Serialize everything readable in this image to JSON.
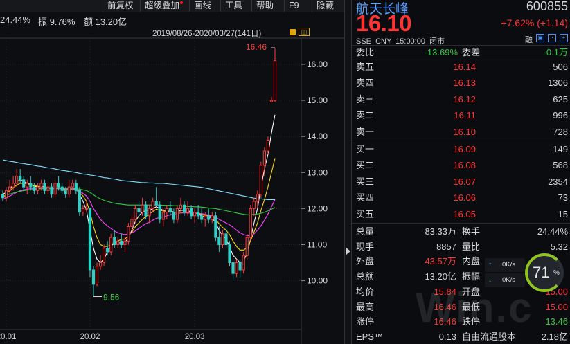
{
  "toolbar": {
    "items": [
      "前复权",
      "超级叠加",
      "画线",
      "工具",
      "帮助",
      "F9",
      "隐藏"
    ]
  },
  "stats": {
    "turnover": "24.44%",
    "amplitude": "振 9.76%",
    "amount": "额 13.20亿"
  },
  "range": "2019/08/26-2020/03/27(141日)",
  "chart_data": {
    "type": "candlestick",
    "title": "",
    "y_ticks": [
      10.0,
      11.0,
      12.0,
      13.0,
      14.0,
      15.0,
      16.0
    ],
    "y_tick_labels": [
      "10.00",
      "11.00",
      "12.00",
      "13.00",
      "14.00",
      "15.00",
      "16.00"
    ],
    "ylim": [
      9.35,
      16.85
    ],
    "x_tick_labels": [
      "20.01",
      "20.02",
      "20.03"
    ],
    "x_tick_index": [
      1,
      25,
      55
    ],
    "annotations": [
      {
        "label": "16.46",
        "index": 78,
        "value": 16.46
      },
      {
        "label": "9.56",
        "index": 26,
        "value": 9.56
      }
    ],
    "candles": [
      [
        12.4,
        12.5,
        12.2,
        12.3
      ],
      [
        12.3,
        12.6,
        12.2,
        12.5
      ],
      [
        12.5,
        12.8,
        12.4,
        12.6
      ],
      [
        12.6,
        12.9,
        12.5,
        12.7
      ],
      [
        12.7,
        13.1,
        12.6,
        12.9
      ],
      [
        12.9,
        13.1,
        12.7,
        12.8
      ],
      [
        12.8,
        12.9,
        12.5,
        12.6
      ],
      [
        12.6,
        12.8,
        12.4,
        12.7
      ],
      [
        12.7,
        12.9,
        12.5,
        12.6
      ],
      [
        12.6,
        12.7,
        12.4,
        12.5
      ],
      [
        12.5,
        12.7,
        12.4,
        12.6
      ],
      [
        12.6,
        12.8,
        12.5,
        12.7
      ],
      [
        12.7,
        12.8,
        12.4,
        12.5
      ],
      [
        12.5,
        12.7,
        12.4,
        12.6
      ],
      [
        12.6,
        12.7,
        12.3,
        12.4
      ],
      [
        12.4,
        12.8,
        12.3,
        12.7
      ],
      [
        12.7,
        12.9,
        12.5,
        12.6
      ],
      [
        12.6,
        12.7,
        12.4,
        12.5
      ],
      [
        12.5,
        12.6,
        12.3,
        12.4
      ],
      [
        12.4,
        12.8,
        12.3,
        12.6
      ],
      [
        12.6,
        12.8,
        12.5,
        12.7
      ],
      [
        12.7,
        12.8,
        12.4,
        12.5
      ],
      [
        12.5,
        12.6,
        11.8,
        11.9
      ],
      [
        11.9,
        12.1,
        11.8,
        12.0
      ],
      [
        12.0,
        12.2,
        11.9,
        12.0
      ],
      [
        12.0,
        12.0,
        10.1,
        10.3
      ],
      [
        10.3,
        10.4,
        9.56,
        9.9
      ],
      [
        9.9,
        10.5,
        9.85,
        10.4
      ],
      [
        10.4,
        10.7,
        10.3,
        10.5
      ],
      [
        10.5,
        11.0,
        10.4,
        10.9
      ],
      [
        10.9,
        11.1,
        10.7,
        10.8
      ],
      [
        10.8,
        11.3,
        10.7,
        11.2
      ],
      [
        11.2,
        11.4,
        10.9,
        11.0
      ],
      [
        11.0,
        11.2,
        10.9,
        11.1
      ],
      [
        11.1,
        11.3,
        10.9,
        11.0
      ],
      [
        11.0,
        11.2,
        10.8,
        11.1
      ],
      [
        11.1,
        11.6,
        11.0,
        11.5
      ],
      [
        11.5,
        11.8,
        11.4,
        11.7
      ],
      [
        11.7,
        12.1,
        11.6,
        12.0
      ],
      [
        12.0,
        12.2,
        11.8,
        11.9
      ],
      [
        11.9,
        12.3,
        11.8,
        12.1
      ],
      [
        12.1,
        12.2,
        11.7,
        11.8
      ],
      [
        11.8,
        12.1,
        11.6,
        12.0
      ],
      [
        12.0,
        12.3,
        11.9,
        12.2
      ],
      [
        12.2,
        12.6,
        12.1,
        12.1
      ],
      [
        12.1,
        12.2,
        11.6,
        11.7
      ],
      [
        11.7,
        12.0,
        11.5,
        11.9
      ],
      [
        11.9,
        12.1,
        11.7,
        12.0
      ],
      [
        12.0,
        12.2,
        11.8,
        11.9
      ],
      [
        11.9,
        12.0,
        11.6,
        11.7
      ],
      [
        11.7,
        12.1,
        11.6,
        12.0
      ],
      [
        12.0,
        12.3,
        11.9,
        12.1
      ],
      [
        12.1,
        12.2,
        11.8,
        11.9
      ],
      [
        11.9,
        12.2,
        11.8,
        12.0
      ],
      [
        12.0,
        12.1,
        11.7,
        11.8
      ],
      [
        11.8,
        12.0,
        11.6,
        11.9
      ],
      [
        11.9,
        12.1,
        11.7,
        11.8
      ],
      [
        11.8,
        12.0,
        11.6,
        11.7
      ],
      [
        11.7,
        11.9,
        11.5,
        11.8
      ],
      [
        11.8,
        12.0,
        11.6,
        11.7
      ],
      [
        11.7,
        11.9,
        11.6,
        11.8
      ],
      [
        11.8,
        11.9,
        11.1,
        11.2
      ],
      [
        11.2,
        11.5,
        10.8,
        11.0
      ],
      [
        11.0,
        11.4,
        10.9,
        11.3
      ],
      [
        11.3,
        11.5,
        10.9,
        11.0
      ],
      [
        11.0,
        11.1,
        10.4,
        10.5
      ],
      [
        10.5,
        10.6,
        10.0,
        10.2
      ],
      [
        10.2,
        10.6,
        10.1,
        10.5
      ],
      [
        10.5,
        10.6,
        10.1,
        10.3
      ],
      [
        10.3,
        10.8,
        10.2,
        10.7
      ],
      [
        10.7,
        11.3,
        10.6,
        11.2
      ],
      [
        11.2,
        12.1,
        11.1,
        12.0
      ],
      [
        12.0,
        12.3,
        11.8,
        12.2
      ],
      [
        12.2,
        12.5,
        12.0,
        12.4
      ],
      [
        12.4,
        13.3,
        12.3,
        13.2
      ],
      [
        13.2,
        13.7,
        12.9,
        13.6
      ],
      [
        13.6,
        14.0,
        13.5,
        13.9
      ],
      [
        14.96,
        15.1,
        14.96,
        15.0
      ],
      [
        15.0,
        16.46,
        14.96,
        16.1
      ]
    ],
    "series": [
      {
        "color": "#ffffff",
        "values": [
          12.4,
          12.45,
          12.55,
          12.65,
          12.75,
          12.8,
          12.75,
          12.7,
          12.68,
          12.62,
          12.6,
          12.62,
          12.6,
          12.58,
          12.55,
          12.55,
          12.58,
          12.56,
          12.52,
          12.52,
          12.55,
          12.55,
          12.4,
          12.2,
          11.95,
          11.4,
          10.9,
          10.6,
          10.5,
          10.6,
          10.8,
          10.95,
          11.05,
          11.05,
          11.05,
          11.05,
          11.2,
          11.4,
          11.65,
          11.8,
          11.9,
          11.95,
          11.95,
          12.0,
          12.05,
          12.0,
          11.95,
          11.95,
          11.95,
          11.9,
          11.9,
          11.95,
          11.95,
          11.95,
          11.9,
          11.88,
          11.85,
          11.8,
          11.78,
          11.76,
          11.75,
          11.6,
          11.4,
          11.25,
          11.15,
          10.95,
          10.7,
          10.6,
          10.5,
          10.55,
          10.75,
          11.15,
          11.6,
          12.0,
          12.6,
          13.1,
          13.5,
          14.1,
          14.6
        ]
      },
      {
        "color": "#ffd700",
        "values": [
          12.3,
          12.4,
          12.5,
          12.58,
          12.65,
          12.7,
          12.7,
          12.68,
          12.66,
          12.64,
          12.62,
          12.6,
          12.6,
          12.58,
          12.56,
          12.55,
          12.56,
          12.55,
          12.53,
          12.52,
          12.53,
          12.53,
          12.45,
          12.35,
          12.2,
          11.9,
          11.5,
          11.2,
          11.0,
          10.95,
          10.95,
          11.0,
          11.05,
          11.1,
          11.15,
          11.15,
          11.25,
          11.35,
          11.5,
          11.6,
          11.7,
          11.78,
          11.85,
          11.92,
          11.98,
          11.95,
          11.93,
          11.92,
          11.92,
          11.9,
          11.9,
          11.9,
          11.9,
          11.9,
          11.9,
          11.88,
          11.86,
          11.84,
          11.82,
          11.8,
          11.78,
          11.7,
          11.58,
          11.48,
          11.4,
          11.28,
          11.1,
          10.95,
          10.85,
          10.85,
          10.92,
          11.1,
          11.35,
          11.6,
          11.95,
          12.25,
          12.6,
          13.0,
          13.4
        ]
      },
      {
        "color": "#ff40ff",
        "values": [
          12.25,
          12.3,
          12.35,
          12.4,
          12.45,
          12.5,
          12.52,
          12.54,
          12.55,
          12.55,
          12.56,
          12.56,
          12.56,
          12.56,
          12.55,
          12.55,
          12.55,
          12.55,
          12.54,
          12.54,
          12.53,
          12.52,
          12.48,
          12.42,
          12.35,
          12.2,
          12.0,
          11.85,
          11.7,
          11.6,
          11.52,
          11.45,
          11.38,
          11.33,
          11.3,
          11.28,
          11.3,
          11.33,
          11.38,
          11.45,
          11.52,
          11.58,
          11.62,
          11.68,
          11.73,
          11.75,
          11.78,
          11.8,
          11.83,
          11.85,
          11.86,
          11.88,
          11.88,
          11.88,
          11.88,
          11.88,
          11.87,
          11.86,
          11.84,
          11.82,
          11.8,
          11.76,
          11.7,
          11.65,
          11.6,
          11.55,
          11.48,
          11.4,
          11.33,
          11.28,
          11.25,
          11.25,
          11.3,
          11.4,
          11.52,
          11.68,
          11.85,
          12.05,
          12.25
        ]
      },
      {
        "color": "#2ecc40",
        "values": [
          12.35,
          12.37,
          12.4,
          12.43,
          12.46,
          12.48,
          12.5,
          12.51,
          12.52,
          12.53,
          12.54,
          12.55,
          12.55,
          12.55,
          12.56,
          12.56,
          12.56,
          12.56,
          12.56,
          12.55,
          12.55,
          12.55,
          12.54,
          12.52,
          12.5,
          12.45,
          12.38,
          12.32,
          12.27,
          12.23,
          12.2,
          12.17,
          12.15,
          12.13,
          12.12,
          12.11,
          12.1,
          12.1,
          12.1,
          12.1,
          12.1,
          12.1,
          12.1,
          12.1,
          12.1,
          12.1,
          12.09,
          12.09,
          12.09,
          12.08,
          12.08,
          12.07,
          12.07,
          12.06,
          12.06,
          12.05,
          12.05,
          12.04,
          12.03,
          12.02,
          12.01,
          12.0,
          11.98,
          11.96,
          11.94,
          11.92,
          11.9,
          11.88,
          11.86,
          11.84,
          11.83,
          11.83,
          11.84,
          11.85,
          11.87,
          11.9,
          11.94,
          11.98,
          12.03
        ]
      },
      {
        "color": "#7fdfff",
        "values": [
          13.35,
          13.33,
          13.31,
          13.3,
          13.28,
          13.26,
          13.25,
          13.23,
          13.22,
          13.2,
          13.18,
          13.17,
          13.15,
          13.13,
          13.12,
          13.1,
          13.08,
          13.06,
          13.05,
          13.03,
          13.02,
          13.0,
          12.98,
          12.96,
          12.95,
          12.93,
          12.92,
          12.9,
          12.88,
          12.86,
          12.85,
          12.83,
          12.82,
          12.8,
          12.78,
          12.77,
          12.76,
          12.75,
          12.74,
          12.73,
          12.72,
          12.72,
          12.71,
          12.71,
          12.7,
          12.7,
          12.7,
          12.69,
          12.68,
          12.67,
          12.66,
          12.65,
          12.64,
          12.63,
          12.62,
          12.61,
          12.6,
          12.59,
          12.57,
          12.55,
          12.53,
          12.51,
          12.49,
          12.47,
          12.45,
          12.43,
          12.41,
          12.39,
          12.37,
          12.35,
          12.33,
          12.31,
          12.29,
          12.28,
          12.27,
          12.26,
          12.25,
          12.25,
          12.25
        ]
      }
    ]
  },
  "quote": {
    "name": "航天长峰",
    "code": "600855",
    "price": "16.10",
    "change": "+7.62% (+1.14)",
    "meta": "SSE  CNY  15:00:00  闭市",
    "tool_label": "融",
    "weibi_label": "委比",
    "weibi_value": "-13.69%",
    "weicha_label": "委差",
    "weicha_value": "-0.1万"
  },
  "asks": [
    {
      "label": "卖五",
      "price": "16.14",
      "vol": "506"
    },
    {
      "label": "卖四",
      "price": "16.13",
      "vol": "1306"
    },
    {
      "label": "卖三",
      "price": "16.12",
      "vol": "625"
    },
    {
      "label": "卖二",
      "price": "16.11",
      "vol": "996"
    },
    {
      "label": "卖一",
      "price": "16.10",
      "vol": "728"
    }
  ],
  "bids": [
    {
      "label": "买一",
      "price": "16.09",
      "vol": "149"
    },
    {
      "label": "买二",
      "price": "16.08",
      "vol": "568"
    },
    {
      "label": "买三",
      "price": "16.07",
      "vol": "2354"
    },
    {
      "label": "买四",
      "price": "16.06",
      "vol": "73"
    },
    {
      "label": "买五",
      "price": "16.05",
      "vol": "15"
    }
  ],
  "stats_table": [
    {
      "l1": "总量",
      "v1": "83.33万",
      "c1": "white",
      "l2": "换手",
      "v2": "24.44%",
      "c2": "white"
    },
    {
      "l1": "现手",
      "v1": "8857",
      "c1": "white",
      "l2": "量比",
      "v2": "5.32",
      "c2": "white"
    },
    {
      "l1": "外盘",
      "v1": "43.57万",
      "c1": "red",
      "l2": "内盘",
      "v2": "",
      "c2": "white"
    },
    {
      "l1": "总额",
      "v1": "13.20亿",
      "c1": "white",
      "l2": "振幅",
      "v2": "",
      "c2": "white"
    },
    {
      "l1": "均价",
      "v1": "15.84",
      "c1": "red",
      "l2": "开盘",
      "v2": "15.00",
      "c2": "red"
    },
    {
      "l1": "最高",
      "v1": "16.46",
      "c1": "red",
      "l2": "最低",
      "v2": "15.00",
      "c2": "red"
    },
    {
      "l1": "涨停",
      "v1": "16.46",
      "c1": "red",
      "l2": "跌停",
      "v2": "13.46",
      "c2": "green"
    },
    {
      "l1": "EPS™",
      "v1": "0.13",
      "c1": "white",
      "l2": "自由流通股本",
      "v2": "2.18亿",
      "c2": "white"
    }
  ],
  "widget": {
    "percent": "71",
    "percent_sign": "%",
    "up_speed": "0K/s",
    "down_speed": "0K/s"
  },
  "watermark": "Win.c"
}
